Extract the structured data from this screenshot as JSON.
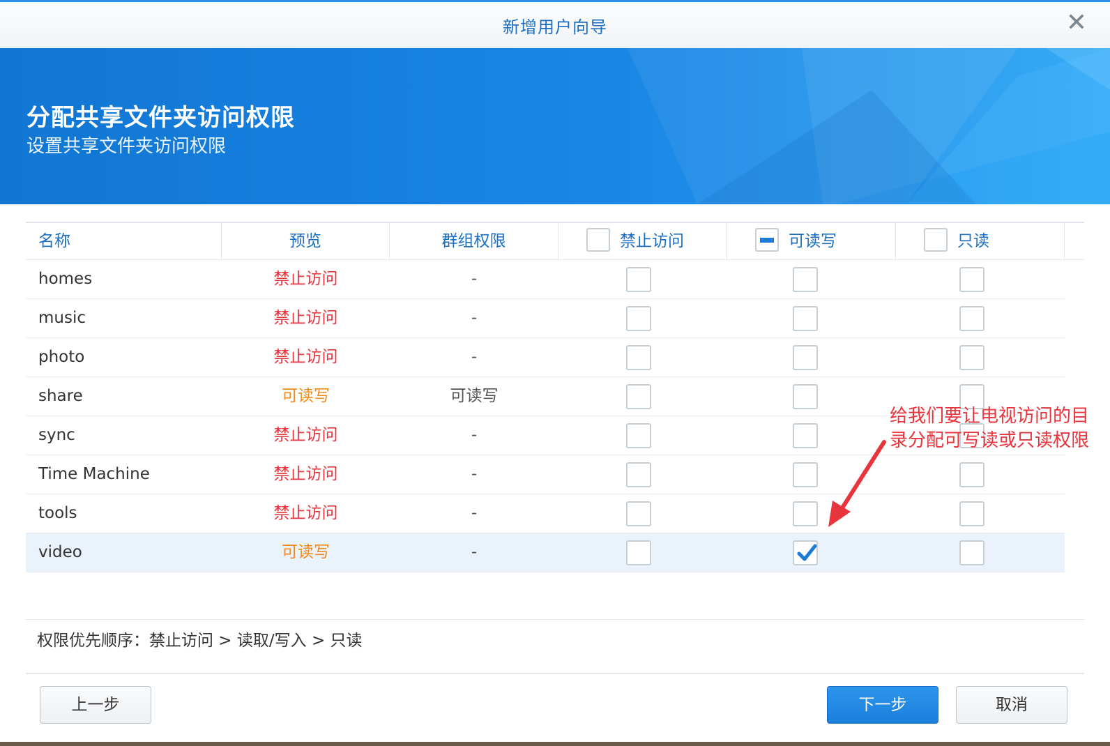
{
  "window": {
    "title": "新增用户向导"
  },
  "banner": {
    "title": "分配共享文件夹访问权限",
    "subtitle": "设置共享文件夹访问权限"
  },
  "table": {
    "headers": {
      "name": "名称",
      "preview": "预览",
      "group": "群组权限",
      "deny": "禁止访问",
      "rw": "可读写",
      "ro": "只读"
    },
    "header_checkbox_state": {
      "deny": "unchecked",
      "rw": "partial",
      "ro": "unchecked"
    },
    "rows": [
      {
        "name": "homes",
        "preview": "禁止访问",
        "preview_color": "red",
        "group": "-",
        "deny": false,
        "rw": false,
        "ro": false
      },
      {
        "name": "music",
        "preview": "禁止访问",
        "preview_color": "red",
        "group": "-",
        "deny": false,
        "rw": false,
        "ro": false
      },
      {
        "name": "photo",
        "preview": "禁止访问",
        "preview_color": "red",
        "group": "-",
        "deny": false,
        "rw": false,
        "ro": false
      },
      {
        "name": "share",
        "preview": "可读写",
        "preview_color": "orange",
        "group": "可读写",
        "deny": false,
        "rw": false,
        "ro": false
      },
      {
        "name": "sync",
        "preview": "禁止访问",
        "preview_color": "red",
        "group": "-",
        "deny": false,
        "rw": false,
        "ro": false
      },
      {
        "name": "Time Machine",
        "preview": "禁止访问",
        "preview_color": "red",
        "group": "-",
        "deny": false,
        "rw": false,
        "ro": false
      },
      {
        "name": "tools",
        "preview": "禁止访问",
        "preview_color": "red",
        "group": "-",
        "deny": false,
        "rw": false,
        "ro": false
      },
      {
        "name": "video",
        "preview": "可读写",
        "preview_color": "orange",
        "group": "-",
        "deny": false,
        "rw": true,
        "ro": false,
        "selected": true
      }
    ]
  },
  "footer": {
    "priority_note": "权限优先顺序：禁止访问 > 读取/写入 > 只读"
  },
  "buttons": {
    "prev": "上一步",
    "next": "下一步",
    "cancel": "取消"
  },
  "annotation": {
    "text": "给我们要让电视访问的目录分配可写读或只读权限"
  },
  "colors": {
    "accent": "#1c7bd6",
    "deny_text": "#e8343c",
    "rw_text": "#f08a1c",
    "annotation": "#e8343c"
  }
}
